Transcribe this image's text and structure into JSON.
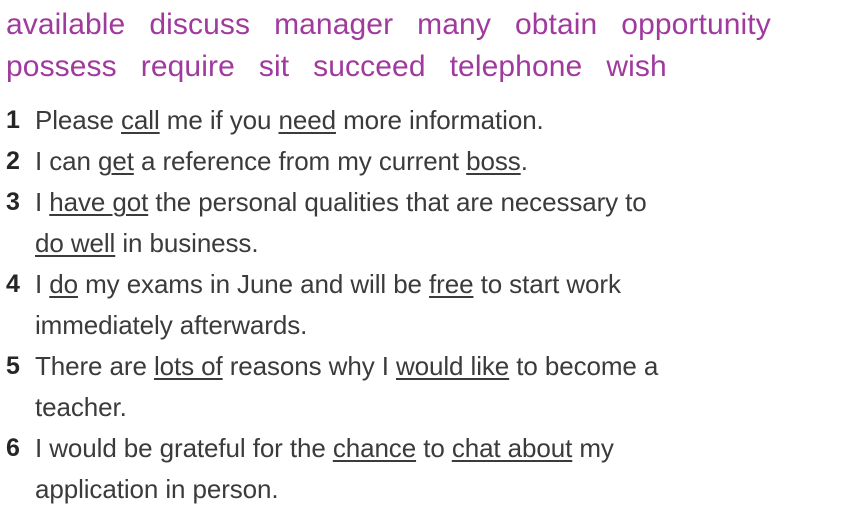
{
  "word_bank": {
    "color": "#a03a9e",
    "lines": [
      [
        "available",
        "discuss",
        "manager",
        "many",
        "obtain",
        "opportunity"
      ],
      [
        "possess",
        "require",
        "sit",
        "succeed",
        "telephone",
        "wish"
      ]
    ]
  },
  "exercise": {
    "text_color": "#3b3b3b",
    "number_color": "#262626",
    "items": [
      {
        "number": "1",
        "lines": [
          [
            {
              "t": "Please ",
              "u": false
            },
            {
              "t": "call",
              "u": true
            },
            {
              "t": " me if you ",
              "u": false
            },
            {
              "t": "need",
              "u": true
            },
            {
              "t": " more information.",
              "u": false
            }
          ]
        ]
      },
      {
        "number": "2",
        "lines": [
          [
            {
              "t": "I can ",
              "u": false
            },
            {
              "t": "get",
              "u": true
            },
            {
              "t": " a reference from my current ",
              "u": false
            },
            {
              "t": "boss",
              "u": true
            },
            {
              "t": ".",
              "u": false
            }
          ]
        ]
      },
      {
        "number": "3",
        "lines": [
          [
            {
              "t": "I ",
              "u": false
            },
            {
              "t": "have got",
              "u": true
            },
            {
              "t": " the personal qualities that are necessary to",
              "u": false
            }
          ],
          [
            {
              "t": "do well",
              "u": true
            },
            {
              "t": " in business.",
              "u": false
            }
          ]
        ]
      },
      {
        "number": "4",
        "lines": [
          [
            {
              "t": "I ",
              "u": false
            },
            {
              "t": "do",
              "u": true
            },
            {
              "t": " my exams in June and will be ",
              "u": false
            },
            {
              "t": "free",
              "u": true
            },
            {
              "t": " to start work",
              "u": false
            }
          ],
          [
            {
              "t": "immediately afterwards.",
              "u": false
            }
          ]
        ]
      },
      {
        "number": "5",
        "lines": [
          [
            {
              "t": "There are ",
              "u": false
            },
            {
              "t": "lots of",
              "u": true
            },
            {
              "t": " reasons why I ",
              "u": false
            },
            {
              "t": "would like",
              "u": true
            },
            {
              "t": " to become a",
              "u": false
            }
          ],
          [
            {
              "t": "teacher.",
              "u": false
            }
          ]
        ]
      },
      {
        "number": "6",
        "lines": [
          [
            {
              "t": "I would be grateful for the ",
              "u": false
            },
            {
              "t": "chance",
              "u": true
            },
            {
              "t": " to ",
              "u": false
            },
            {
              "t": "chat about",
              "u": true
            },
            {
              "t": " my",
              "u": false
            }
          ],
          [
            {
              "t": "application in person.",
              "u": false
            }
          ]
        ]
      }
    ]
  }
}
